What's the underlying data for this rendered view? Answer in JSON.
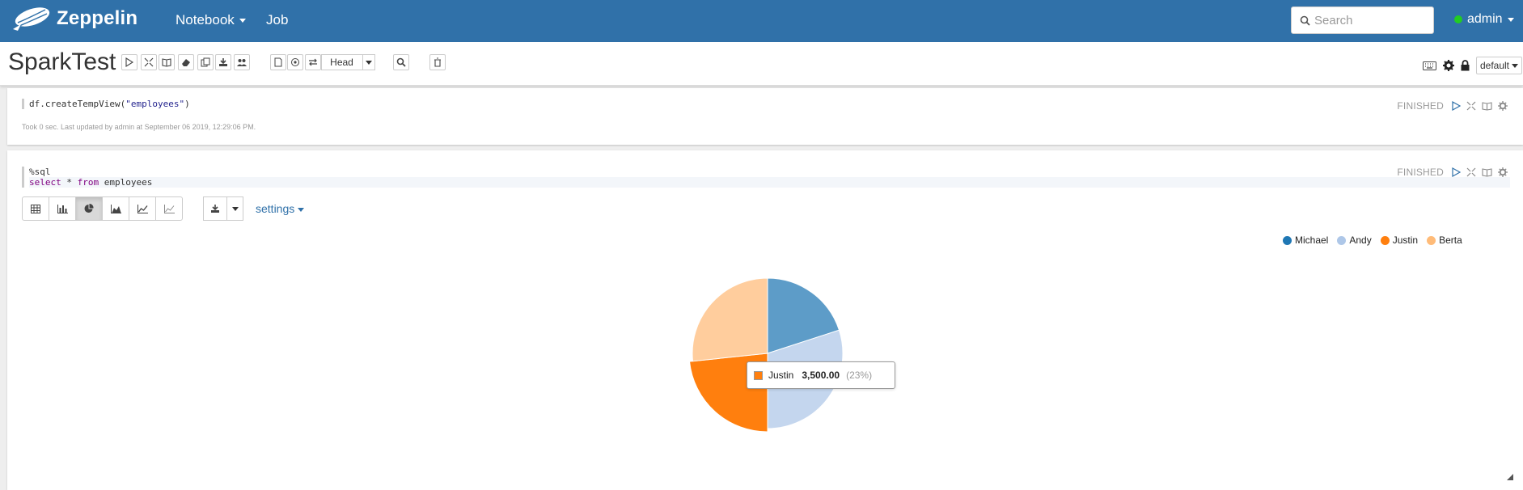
{
  "navbar": {
    "brand": "Zeppelin",
    "menu": [
      {
        "label": "Notebook",
        "has_caret": true
      },
      {
        "label": "Job",
        "has_caret": false
      }
    ],
    "search_placeholder": "Search",
    "user": "admin",
    "user_status_color": "#22cc22",
    "bar_color": "#3071a9"
  },
  "note": {
    "title": "SparkTest",
    "toolbar_icons": [
      "run-all-icon",
      "hide-code-icon",
      "hide-output-icon",
      "clear-output-icon",
      "clone-icon",
      "export-icon",
      "collaborate-icon",
      "version-control-icon",
      "commit-icon",
      "compare-icon"
    ],
    "revision_select": "Head",
    "search_code_icon": "search-icon",
    "delete_icon": "trash-icon",
    "right_tools": [
      "keyboard-icon",
      "gear-icon",
      "lock-icon"
    ],
    "interpreter_select": "default"
  },
  "paragraph1": {
    "code_prefix": "df.createTempView(",
    "code_string": "\"employees\"",
    "code_suffix": ")",
    "footer": "Took 0 sec. Last updated by admin at September 06 2019, 12:29:06 PM.",
    "status": "FINISHED"
  },
  "paragraph2": {
    "code_line1": "%sql",
    "code_line2_kw1": "select",
    "code_line2_mid": " * ",
    "code_line2_kw2": "from",
    "code_line2_rest": " employees",
    "status": "FINISHED",
    "viz_buttons": [
      "table-icon",
      "bar-chart-icon",
      "pie-chart-icon",
      "area-chart-icon",
      "line-chart-icon",
      "scatter-chart-icon"
    ],
    "active_viz": "pie-chart-icon",
    "settings_label": "settings"
  },
  "chart_data": {
    "type": "pie",
    "categories": [
      "Michael",
      "Andy",
      "Justin",
      "Berta"
    ],
    "values": [
      3000,
      4500,
      3500,
      4000
    ],
    "colors": [
      "#1f77b4",
      "#aec7e8",
      "#ff7f0e",
      "#ffbb78"
    ],
    "legend_position": "top-right",
    "tooltip": {
      "category": "Justin",
      "value_label": "3,500.00",
      "percent_label": "(23%)",
      "color": "#ff7f0e"
    }
  }
}
